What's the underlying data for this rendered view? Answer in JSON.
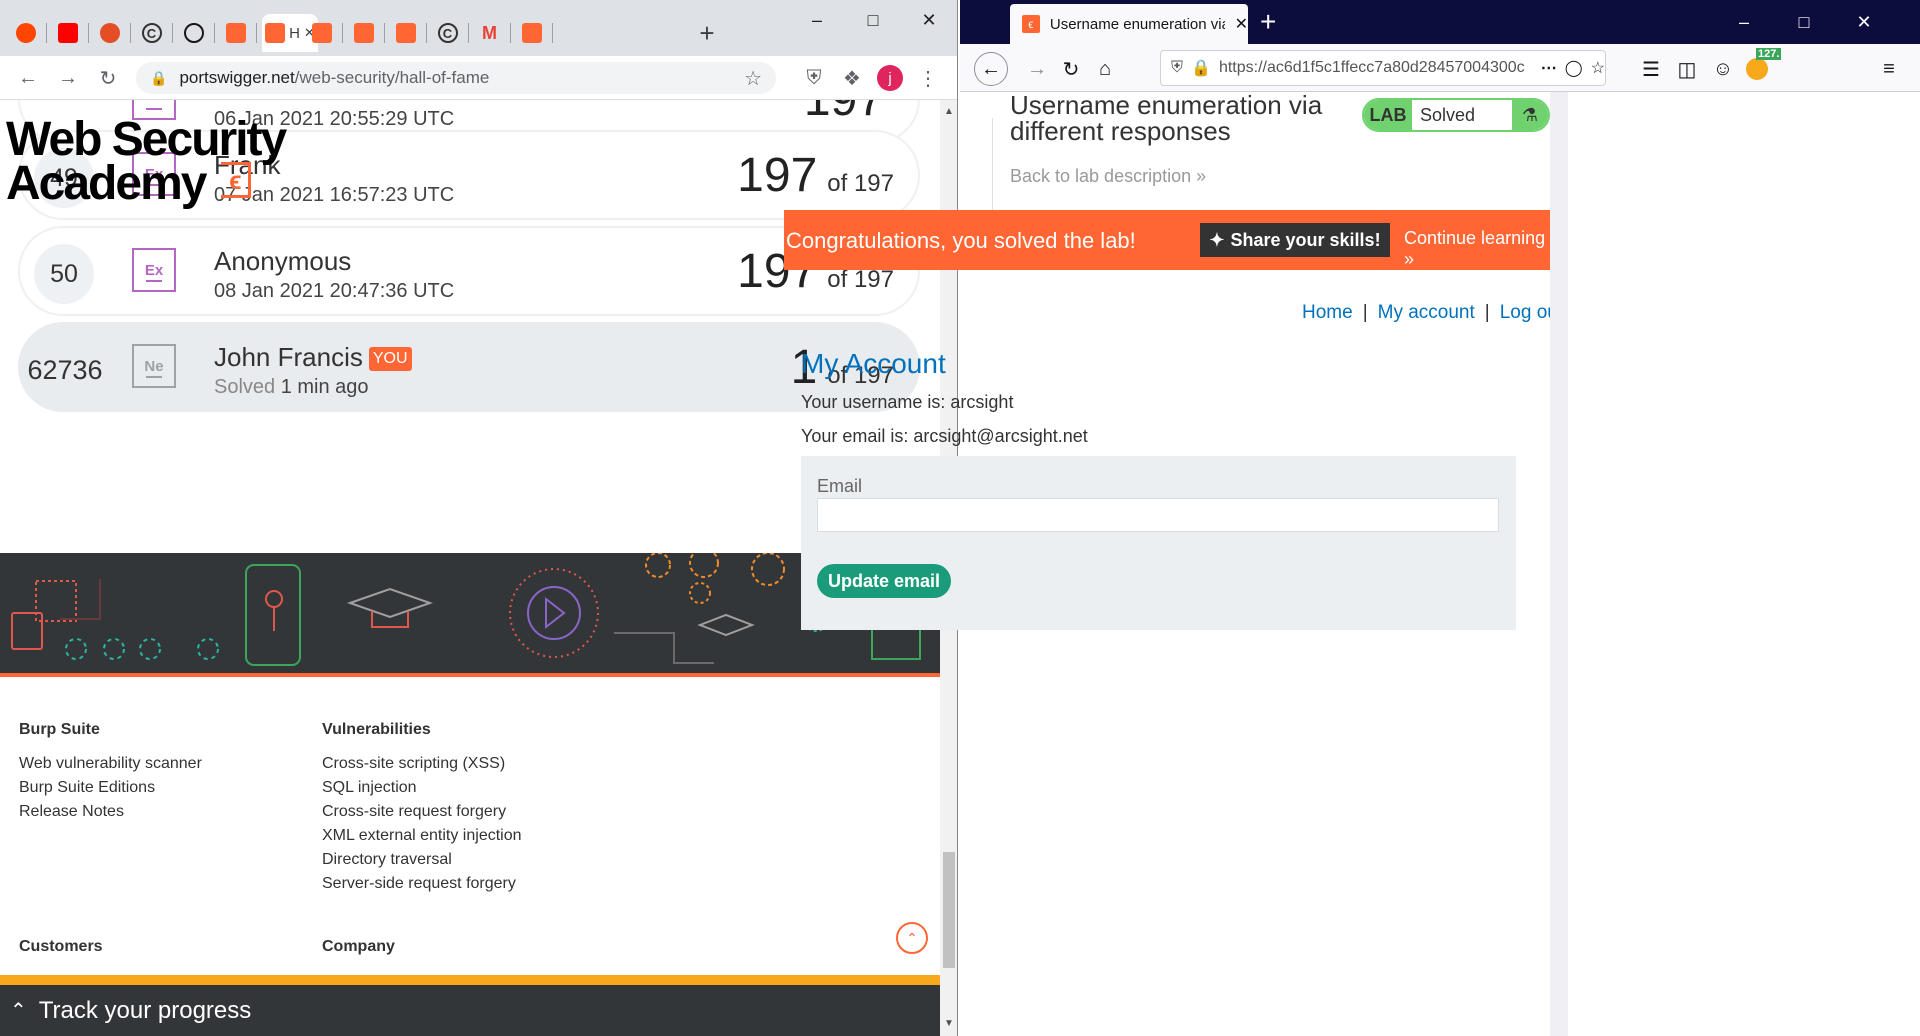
{
  "left_browser": {
    "tabs": [
      {
        "icon": "reddit-icon",
        "color": "#ff4500"
      },
      {
        "icon": "youtube-icon",
        "color": "#ff0000"
      },
      {
        "icon": "web-icon",
        "color": "#e44d26"
      },
      {
        "icon": "c-icon",
        "color": "#333333"
      },
      {
        "icon": "github-icon",
        "color": "#181717"
      },
      {
        "icon": "portswigger-icon",
        "color": "#ff6633"
      },
      {
        "icon": "portswigger-icon",
        "color": "#ff6633",
        "active": true
      },
      {
        "icon": "portswigger-icon",
        "color": "#ff6633"
      },
      {
        "icon": "portswigger-icon",
        "color": "#ff6633"
      },
      {
        "icon": "portswigger-icon",
        "color": "#ff6633"
      },
      {
        "icon": "c-icon",
        "color": "#333333"
      },
      {
        "icon": "gmail-icon",
        "color": "#ea4335"
      },
      {
        "icon": "portswigger-icon",
        "color": "#ff6633"
      }
    ],
    "active_tab_char": "H",
    "url_host": "portswigger.net",
    "url_path": "/web-security/hall-of-fame",
    "profile_initial": "j",
    "leaderboard": [
      {
        "rank": "",
        "badge": "",
        "name": "",
        "date": "06 Jan 2021 20:55:29 UTC",
        "score": "197",
        "of": "",
        "partial": true
      },
      {
        "rank": "49",
        "badge": "Ex",
        "name": "Frank",
        "date": "07 Jan 2021 16:57:23 UTC",
        "score": "197",
        "of": "of 197"
      },
      {
        "rank": "50",
        "badge": "Ex",
        "name": "Anonymous",
        "date": "08 Jan 2021 20:47:36 UTC",
        "score": "197",
        "of": "of 197"
      },
      {
        "rank": "62736",
        "badge": "Ne",
        "name": "John Francis",
        "you": "YOU",
        "solved_label": "Solved",
        "solved_time": "1 min ago",
        "score": "1",
        "of": "of 197"
      }
    ],
    "footer": {
      "burp": {
        "heading": "Burp Suite",
        "links": [
          "Web vulnerability scanner",
          "Burp Suite Editions",
          "Release Notes"
        ]
      },
      "vulns": {
        "heading": "Vulnerabilities",
        "links": [
          "Cross-site scripting (XSS)",
          "SQL injection",
          "Cross-site request forgery",
          "XML external entity injection",
          "Directory traversal",
          "Server-side request forgery"
        ]
      },
      "customers": "Customers",
      "company": "Company"
    },
    "track_progress": "Track your progress"
  },
  "right_browser": {
    "tab_title": "Username enumeration via diff",
    "url": "https://ac6d1f5c1ffecc7a80d28457004300c",
    "ext_badge": "127.",
    "logo_line1": "Web Security",
    "logo_line2": "Academy",
    "lab_title_line1": "Username enumeration via",
    "lab_title_line2": "different responses",
    "back_link": "Back to lab description",
    "lab_label": "LAB",
    "lab_status": "Solved",
    "congrats": "Congratulations, you solved the lab!",
    "share": "Share your skills!",
    "continue": "Continue learning",
    "nav": {
      "home": "Home",
      "account": "My account",
      "logout": "Log out",
      "sep": "|"
    },
    "heading": "My Account",
    "username_line": "Your username is: arcsight",
    "email_line": "Your email is: arcsight@arcsight.net",
    "email_label": "Email",
    "email_value": "",
    "update_button": "Update email"
  },
  "colors": {
    "accent": "#ff6633",
    "link": "#0071bc",
    "green": "#70d26e",
    "teal": "#1a9c7a"
  }
}
